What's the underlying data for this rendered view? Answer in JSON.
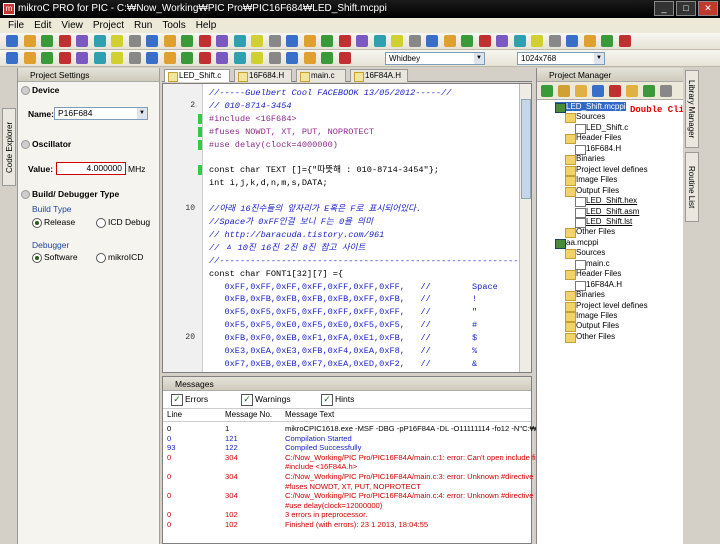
{
  "window": {
    "title": "mikroC PRO for PIC - C:₩Now_Working₩PIC Pro₩PIC16F684₩LED_Shift.mcppi",
    "app_icon": "mikroC logo"
  },
  "menu": [
    "File",
    "Edit",
    "View",
    "Project",
    "Run",
    "Tools",
    "Help"
  ],
  "toolbar": {
    "scheme_combo": "Whidbey",
    "resolution_combo": "1024x768"
  },
  "left_tabs": [
    "Code Explorer"
  ],
  "project_settings": {
    "title": "Project Settings",
    "device_section": "Device",
    "name_label": "Name:",
    "device_name": "P16F684",
    "oscillator_section": "Oscillator",
    "value_label": "Value:",
    "osc_value": "4.000000",
    "osc_unit": "MHz",
    "build_section": "Build/ Debugger Type",
    "build_type_label": "Build Type",
    "release_label": "Release",
    "icd_label": "ICD Debug",
    "debugger_label": "Debugger",
    "software_label": "Software",
    "mikroicd_label": "mikroICD"
  },
  "editor_tabs": [
    "LED_Shift.c",
    "16F684.H",
    "main.c",
    "16F84A.H"
  ],
  "code": [
    {
      "ln": "",
      "text": "//-----Guelbert Cool FACEBOOK 13/05/2012-----//",
      "cls": "c-com"
    },
    {
      "ln": "2",
      "text": "// 010-8714-3454",
      "cls": "c-com"
    },
    {
      "ln": "",
      "text": "#include <16F684>",
      "cls": "c-pre",
      "mark": true
    },
    {
      "ln": "",
      "text": "#fuses NOWDT, XT, PUT, NOPROTECT",
      "cls": "c-pre",
      "mark": true
    },
    {
      "ln": "",
      "text": "#use delay(clock=4000000)",
      "cls": "c-pre",
      "mark": true
    },
    {
      "ln": "",
      "text": "",
      "cls": ""
    },
    {
      "ln": "",
      "text": "const char TEXT []={\"따뜻해 : 010-8714-3454\"};",
      "cls": "c-kw",
      "mark": true
    },
    {
      "ln": "",
      "text": "int i,j,k,d,n,m,s,DATA;",
      "cls": "c-kw"
    },
    {
      "ln": "",
      "text": "",
      "cls": ""
    },
    {
      "ln": "10",
      "text": "//아래 16진수들의 앞자리가 E혹은 F로 표시되어있다.",
      "cls": "c-com"
    },
    {
      "ln": "",
      "text": "//Space가 0xFF인걸 보니 F는 0을 의미",
      "cls": "c-com"
    },
    {
      "ln": "",
      "text": "// http://baracuda.tistory.com/961",
      "cls": "c-com"
    },
    {
      "ln": "",
      "text": "// ㅿ 10진 16진 2진 8진 참고 사이트",
      "cls": "c-com"
    },
    {
      "ln": "",
      "text": "//----------------------------------------------------------",
      "cls": "c-com"
    },
    {
      "ln": "",
      "text": "const char FONT1[32][7] ={",
      "cls": "c-kw"
    },
    {
      "ln": "",
      "text": "   0xFF,0xFF,0xFF,0xFF,0xFF,0xFF,0xFF,   //        Space",
      "cls": "c-str"
    },
    {
      "ln": "",
      "text": "   0xFB,0xFB,0xFB,0xFB,0xFB,0xFF,0xFB,   //        !",
      "cls": "c-str"
    },
    {
      "ln": "",
      "text": "   0xF5,0xF5,0xF5,0xFF,0xFF,0xFF,0xFF,   //        \"",
      "cls": "c-str"
    },
    {
      "ln": "",
      "text": "   0xF5,0xF5,0xE0,0xF5,0xE0,0xF5,0xF5,   //        #",
      "cls": "c-str"
    },
    {
      "ln": "20",
      "text": "   0xFB,0xF0,0xEB,0xF1,0xFA,0xE1,0xFB,   //        $",
      "cls": "c-str"
    },
    {
      "ln": "",
      "text": "   0xE3,0xEA,0xE3,0xFB,0xF4,0xEA,0xF8,   //        %",
      "cls": "c-str"
    },
    {
      "ln": "",
      "text": "   0xF7,0xEB,0xEB,0xF7,0xEA,0xED,0xF2,   //        &",
      "cls": "c-str"
    }
  ],
  "project_manager": {
    "title": "Project Manager",
    "tree": [
      {
        "label": "LED_Shift.mcppi",
        "kind": "proj",
        "depth": 0,
        "sel": true
      },
      {
        "label": "Sources",
        "kind": "folder",
        "depth": 1
      },
      {
        "label": "LED_Shift.c",
        "kind": "file",
        "depth": 2
      },
      {
        "label": "Header Files",
        "kind": "folder",
        "depth": 1
      },
      {
        "label": "16F684.H",
        "kind": "file",
        "depth": 2
      },
      {
        "label": "Binaries",
        "kind": "folder",
        "depth": 1
      },
      {
        "label": "Project level defines",
        "kind": "folder",
        "depth": 1
      },
      {
        "label": "Image Files",
        "kind": "folder",
        "depth": 1
      },
      {
        "label": "Output Files",
        "kind": "folder",
        "depth": 1
      },
      {
        "label": "LED_Shift.hex",
        "kind": "file",
        "depth": 2,
        "ul": true
      },
      {
        "label": "LED_Shift.asm",
        "kind": "file",
        "depth": 2,
        "ul": true
      },
      {
        "label": "LED_Shift.lst",
        "kind": "file",
        "depth": 2,
        "ul": true
      },
      {
        "label": "Other Files",
        "kind": "folder",
        "depth": 1
      },
      {
        "label": "aa.mcppi",
        "kind": "proj",
        "depth": 0
      },
      {
        "label": "Sources",
        "kind": "folder",
        "depth": 1
      },
      {
        "label": "main.c",
        "kind": "file",
        "depth": 2
      },
      {
        "label": "Header Files",
        "kind": "folder",
        "depth": 1
      },
      {
        "label": "16F84A.H",
        "kind": "file",
        "depth": 2
      },
      {
        "label": "Binaries",
        "kind": "folder",
        "depth": 1
      },
      {
        "label": "Project level defines",
        "kind": "folder",
        "depth": 1
      },
      {
        "label": "Image Files",
        "kind": "folder",
        "depth": 1
      },
      {
        "label": "Output Files",
        "kind": "folder",
        "depth": 1
      },
      {
        "label": "Other Files",
        "kind": "folder",
        "depth": 1
      }
    ],
    "annotation": "Double Click"
  },
  "right_tabs": [
    "Library Manager",
    "Routine List"
  ],
  "messages": {
    "title": "Messages",
    "filters": [
      "Errors",
      "Warnings",
      "Hints"
    ],
    "headers": [
      "Line",
      "Message No.",
      "Message Text"
    ],
    "rows": [
      {
        "line": "0",
        "no": "1",
        "text": "mikroCPIC1618.exe -MSF -DBG -pP16F84A -DL -O11111114 -fo12 -N\"C:₩Now",
        "color": "#000"
      },
      {
        "line": "0",
        "no": "121",
        "text": "Compilation Started",
        "color": "#1a22c8"
      },
      {
        "line": "93",
        "no": "122",
        "text": "Compiled Successfully",
        "color": "#1a22c8"
      },
      {
        "line": "0",
        "no": "304",
        "text": "C:/Now_Working/PIC Pro/PIC16F84A/main.c:1: error: Can't open include file",
        "color": "#d00000"
      },
      {
        "line": "",
        "no": "",
        "text": "     #include <16F84A.h>",
        "color": "#d00000"
      },
      {
        "line": "0",
        "no": "304",
        "text": "C:/Now_Working/PIC Pro/PIC16F84A/main.c:3: error: Unknown #directive 'fu",
        "color": "#d00000"
      },
      {
        "line": "",
        "no": "",
        "text": "     #fuses NOWDT, XT, PUT, NOPROTECT",
        "color": "#d00000"
      },
      {
        "line": "0",
        "no": "304",
        "text": "C:/Now_Working/PIC Pro/PIC16F84A/main.c:4: error: Unknown #directive 'u",
        "color": "#d00000"
      },
      {
        "line": "",
        "no": "",
        "text": "     #use delay(clock=12000000)",
        "color": "#d00000"
      },
      {
        "line": "0",
        "no": "102",
        "text": "3 errors in preprocessor.",
        "color": "#d00000"
      },
      {
        "line": "0",
        "no": "102",
        "text": "Finished (with errors): 23 1 2013, 18:04:55",
        "color": "#d00000"
      }
    ]
  }
}
